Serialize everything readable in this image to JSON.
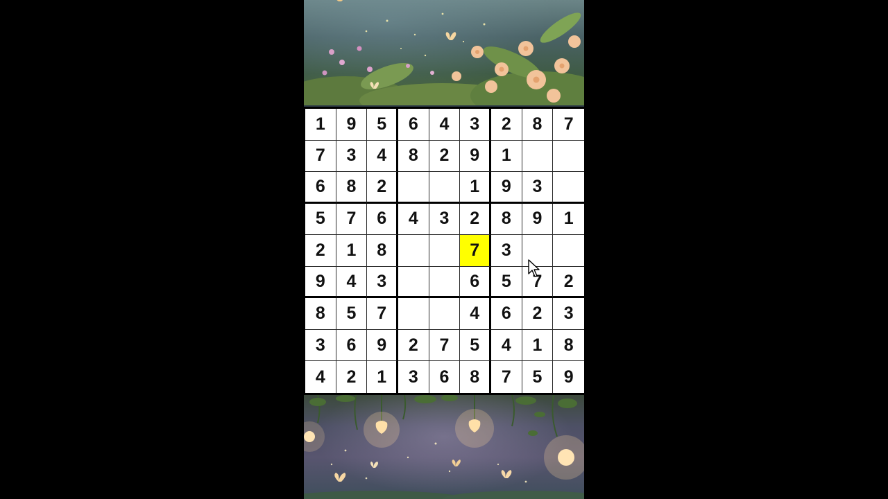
{
  "game": {
    "title": "",
    "selected": {
      "row": 4,
      "col": 5
    },
    "highlight_color": "#ffff00",
    "grid": [
      [
        "1",
        "9",
        "5",
        "6",
        "4",
        "3",
        "2",
        "8",
        "7"
      ],
      [
        "7",
        "3",
        "4",
        "8",
        "2",
        "9",
        "1",
        "",
        ""
      ],
      [
        "6",
        "8",
        "2",
        "",
        "",
        "1",
        "9",
        "3",
        ""
      ],
      [
        "5",
        "7",
        "6",
        "4",
        "3",
        "2",
        "8",
        "9",
        "1"
      ],
      [
        "2",
        "1",
        "8",
        "",
        "",
        "7",
        "3",
        "",
        ""
      ],
      [
        "9",
        "4",
        "3",
        "",
        "",
        "6",
        "5",
        "7",
        "2"
      ],
      [
        "8",
        "5",
        "7",
        "",
        "",
        "4",
        "6",
        "2",
        "3"
      ],
      [
        "3",
        "6",
        "9",
        "2",
        "7",
        "5",
        "4",
        "1",
        "8"
      ],
      [
        "4",
        "2",
        "1",
        "3",
        "6",
        "8",
        "7",
        "5",
        "9"
      ]
    ]
  },
  "decor": {
    "top_banner": "flowers-fireflies-illustration",
    "bottom_banner": "lanterns-butterflies-illustration",
    "cursor_icon": "arrow-cursor-icon"
  }
}
